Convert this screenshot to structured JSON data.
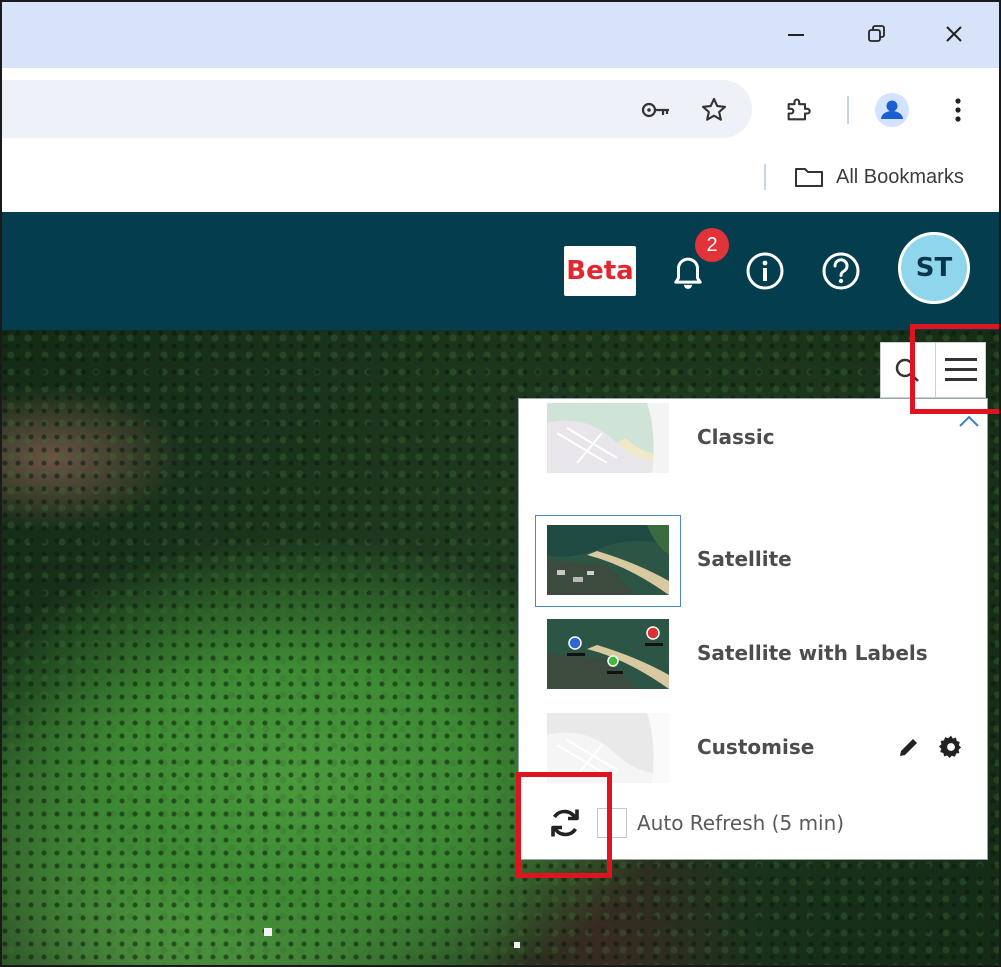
{
  "browser": {
    "window_controls": [
      "minimize",
      "restore",
      "close"
    ],
    "bookmarks_bar": {
      "all_bookmarks_label": "All Bookmarks"
    }
  },
  "app_header": {
    "beta_label": "Beta",
    "notification_count": "2",
    "avatar_initials": "ST",
    "background_color": "#033d4e"
  },
  "layer_panel": {
    "layers": [
      {
        "label": "Classic",
        "selected": false
      },
      {
        "label": "Satellite",
        "selected": true
      },
      {
        "label": "Satellite with Labels",
        "selected": false
      },
      {
        "label": "Customise",
        "selected": false
      }
    ],
    "auto_refresh_label": "Auto Refresh (5 min)",
    "auto_refresh_checked": false
  },
  "colors": {
    "highlight": "#e0141e",
    "selected_border": "#4a86c8",
    "beta_red": "#e3262f"
  }
}
